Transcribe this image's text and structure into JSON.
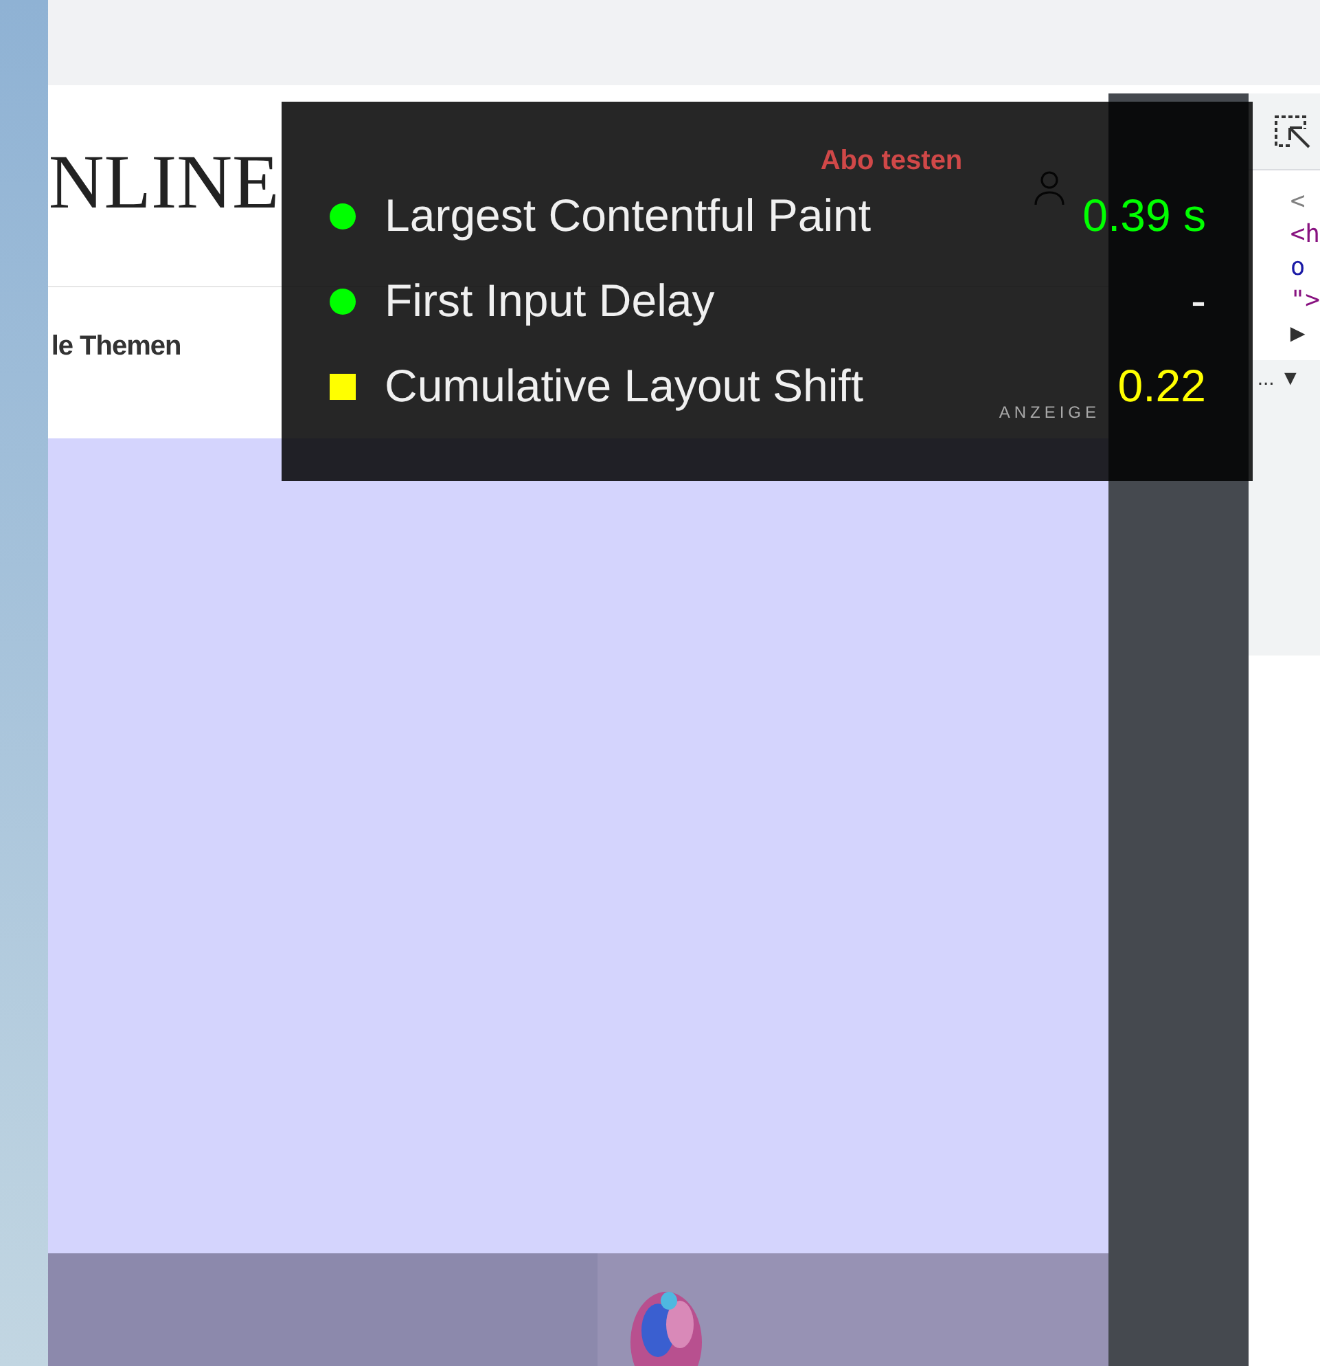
{
  "page": {
    "logo": "NLINE",
    "subscribe_link": "Abo testen",
    "nav_item": "le Themen",
    "ad_label": "ANZEIGE"
  },
  "vitals_overlay": {
    "metrics": [
      {
        "label": "Largest Contentful Paint",
        "value": "0.39 s",
        "kind": "dot",
        "color": "#00ff00"
      },
      {
        "label": "First Input Delay",
        "value": "-",
        "kind": "dot",
        "color": "#00ff00"
      },
      {
        "label": "Cumulative Layout Shift",
        "value": "0.22",
        "kind": "square",
        "color": "#ffff00"
      }
    ]
  },
  "devtools": {
    "lines": [
      {
        "text": "<",
        "color": "#808080"
      },
      {
        "text": "<h",
        "color": "#881280"
      },
      {
        "text": "o",
        "color": "#1a1aa6"
      },
      {
        "text": "\">",
        "color": "#881280"
      },
      {
        "text": "▶",
        "color": "#303030"
      }
    ],
    "collapsed_line": "... ▼"
  }
}
